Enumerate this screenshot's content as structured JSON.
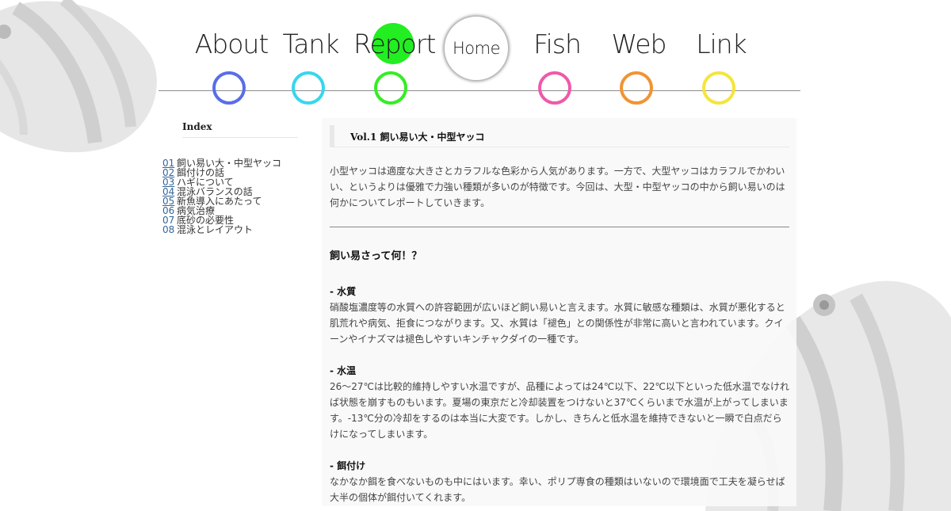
{
  "nav": {
    "items": [
      {
        "label": "About",
        "color": "#5a6de8"
      },
      {
        "label": "Tank",
        "color": "#38d6ee"
      },
      {
        "label": "Report",
        "color": "#33ee22",
        "active": true
      },
      {
        "label": "Home"
      },
      {
        "label": "Fish",
        "color": "#ee5aa8"
      },
      {
        "label": "Web",
        "color": "#f09433"
      },
      {
        "label": "Link",
        "color": "#f4e53b"
      }
    ],
    "active_dot_color": "#22ee22"
  },
  "sidebar": {
    "title": "Index",
    "items": [
      {
        "num": "01",
        "text": "飼い易い大・中型ヤッコ"
      },
      {
        "num": "02",
        "text": "餌付けの話"
      },
      {
        "num": "03",
        "text": "ハギについて"
      },
      {
        "num": "04",
        "text": "混泳バランスの話"
      },
      {
        "num": "05",
        "text": "新魚導入にあたって"
      },
      {
        "num": "06",
        "text": "病気治療"
      },
      {
        "num": "07",
        "text": "底砂の必要性"
      },
      {
        "num": "08",
        "text": "混泳とレイアウト"
      }
    ]
  },
  "main": {
    "title": "Vol.1 飼い易い大・中型ヤッコ",
    "intro": "小型ヤッコは適度な大きさとカラフルな色彩から人気があります。一方で、大型ヤッコはカラフルでかわいい、というよりは優雅で力強い種類が多いのが特徴です。今回は、大型・中型ヤッコの中から飼い易いのは何かについてレポートしていきます。",
    "section_heading": "飼い易さって何！？",
    "sections": [
      {
        "heading": "- 水質",
        "body": "硝酸塩濃度等の水質への許容範囲が広いほど飼い易いと言えます。水質に敏感な種類は、水質が悪化すると肌荒れや病気、拒食につながります。又、水質は「褪色」との関係性が非常に高いと言われています。クイーンやイナズマは褪色しやすいキンチャクダイの一種です。"
      },
      {
        "heading": "- 水温",
        "body": "26～27℃は比較的維持しやすい水温ですが、品種によっては24℃以下、22℃以下といった低水温でなければ状態を崩すものもいます。夏場の東京だと冷却装置をつけないと37℃くらいまで水温が上がってしまいます。-13℃分の冷却をするのは本当に大変です。しかし、きちんと低水温を維持できないと一瞬で白点だらけになってしまいます。"
      },
      {
        "heading": "- 餌付け",
        "body": "なかなか餌を食べないものも中にはいます。幸い、ポリプ専食の種類はいないので環境面で工夫を凝らせば大半の個体が餌付いてくれます。"
      }
    ]
  }
}
